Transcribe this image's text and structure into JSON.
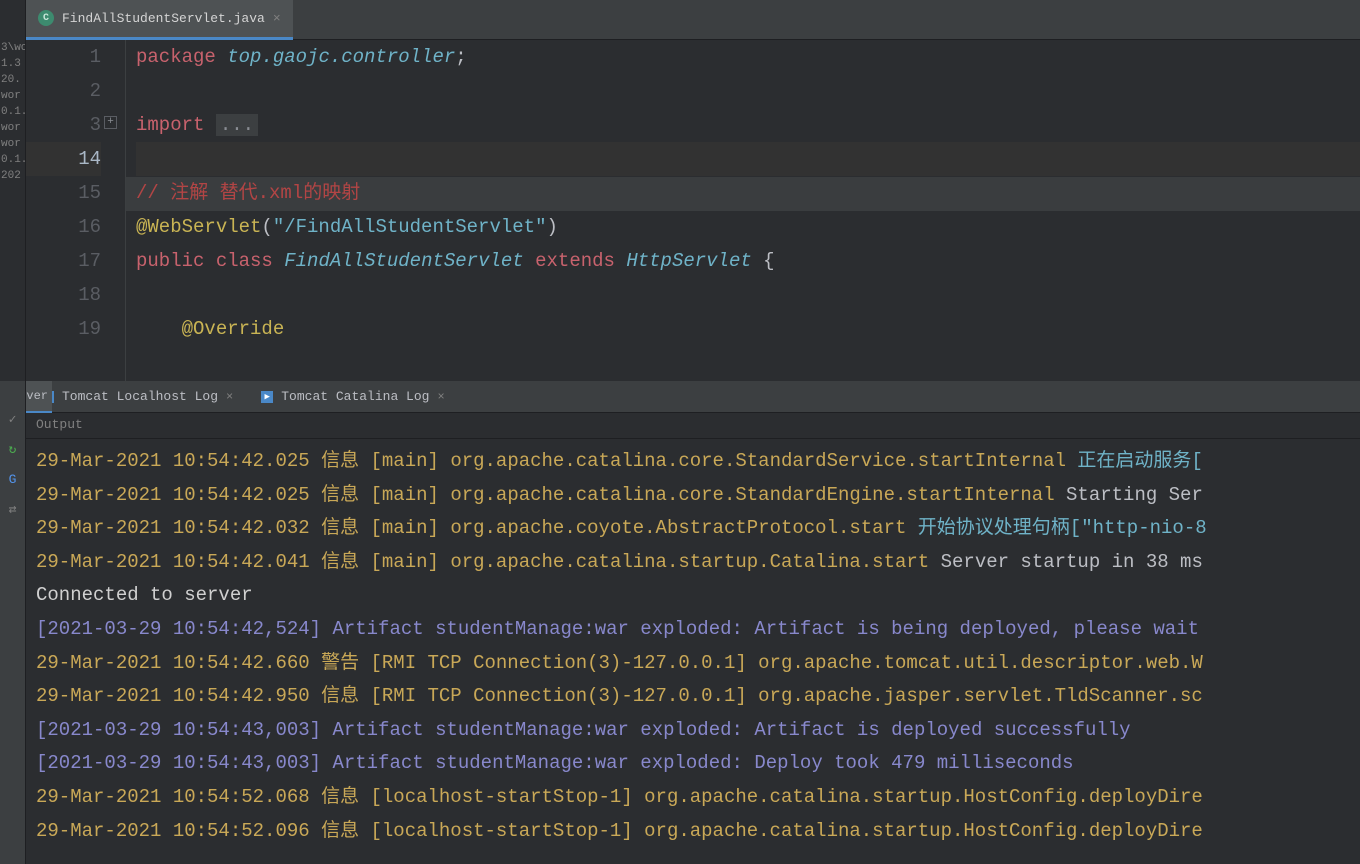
{
  "tab": {
    "iconLetter": "C",
    "filename": "FindAllStudentServlet.java",
    "closeGlyph": "×"
  },
  "leftStrip": [
    "3\\wo",
    "1.3",
    "20.",
    "wor",
    "0.1.",
    "wor",
    "wor",
    "0.1.",
    "202"
  ],
  "gutter": {
    "nums": [
      "1",
      "2",
      "3",
      "14",
      "15",
      "16",
      "17",
      "18",
      "19"
    ],
    "currentIdx": 3,
    "foldIdx": 2,
    "foldGlyph": "+"
  },
  "code": {
    "package_kw": "package",
    "package_name": "top.gaojc.controller",
    "semi": ";",
    "import_kw": "import",
    "import_fold": "...",
    "comment": "// 注解 替代.xml的映射",
    "ann": "@WebServlet",
    "ann_open": "(",
    "ann_str": "\"/FindAllStudentServlet\"",
    "ann_close": ")",
    "public_kw": "public",
    "class_kw": "class",
    "class_name": "FindAllStudentServlet",
    "extends_kw": "extends",
    "super_name": "HttpServlet",
    "brace": "{",
    "override": "@Override"
  },
  "logTabs": {
    "activeCover": "ver",
    "one": "Tomcat Localhost Log",
    "two": "Tomcat Catalina Log",
    "arrow": "▶",
    "close": "×"
  },
  "outputLabel": "Output",
  "toolIcons": {
    "check": "✓",
    "refresh": "↻",
    "cog": "G",
    "dbg": "⇄"
  },
  "console": [
    {
      "type": "log",
      "ts": "29-Mar-2021 10:54:42.025",
      "lvl": "信息",
      "thr": "[main]",
      "cat": "org.apache.catalina.core.StandardService.startInternal",
      "msg": "正在启动服务[",
      "msgcls": "msg-cn"
    },
    {
      "type": "log",
      "ts": "29-Mar-2021 10:54:42.025",
      "lvl": "信息",
      "thr": "[main]",
      "cat": "org.apache.catalina.core.StandardEngine.startInternal",
      "msg": "Starting Ser",
      "msgcls": "msg-w"
    },
    {
      "type": "log",
      "ts": "29-Mar-2021 10:54:42.032",
      "lvl": "信息",
      "thr": "[main]",
      "cat": "org.apache.coyote.AbstractProtocol.start",
      "msg": "开始协议处理句柄[\"http-nio-8",
      "msgcls": "msg-cn"
    },
    {
      "type": "log",
      "ts": "29-Mar-2021 10:54:42.041",
      "lvl": "信息",
      "thr": "[main]",
      "cat": "org.apache.catalina.startup.Catalina.start",
      "msg": "Server startup in 38 ms",
      "msgcls": "msg-w"
    },
    {
      "type": "conn",
      "text": "Connected to server"
    },
    {
      "type": "art",
      "text": "[2021-03-29 10:54:42,524] Artifact studentManage:war exploded: Artifact is being deployed, please wait"
    },
    {
      "type": "log",
      "ts": "29-Mar-2021 10:54:42.660",
      "lvl": "警告",
      "thr": "[RMI TCP Connection(3)-127.0.0.1]",
      "cat": "org.apache.tomcat.util.descriptor.web.W",
      "msg": "",
      "msgcls": "msg-w"
    },
    {
      "type": "log",
      "ts": "29-Mar-2021 10:54:42.950",
      "lvl": "信息",
      "thr": "[RMI TCP Connection(3)-127.0.0.1]",
      "cat": "org.apache.jasper.servlet.TldScanner.sc",
      "msg": "",
      "msgcls": "msg-w"
    },
    {
      "type": "art",
      "text": "[2021-03-29 10:54:43,003] Artifact studentManage:war exploded: Artifact is deployed successfully"
    },
    {
      "type": "art",
      "text": "[2021-03-29 10:54:43,003] Artifact studentManage:war exploded: Deploy took 479 milliseconds"
    },
    {
      "type": "log",
      "ts": "29-Mar-2021 10:54:52.068",
      "lvl": "信息",
      "thr": "[localhost-startStop-1]",
      "cat": "org.apache.catalina.startup.HostConfig.deployDire",
      "msg": "",
      "msgcls": "msg-w"
    },
    {
      "type": "log",
      "ts": "29-Mar-2021 10:54:52.096",
      "lvl": "信息",
      "thr": "[localhost-startStop-1]",
      "cat": "org.apache.catalina.startup.HostConfig.deployDire",
      "msg": "",
      "msgcls": "msg-w"
    }
  ]
}
